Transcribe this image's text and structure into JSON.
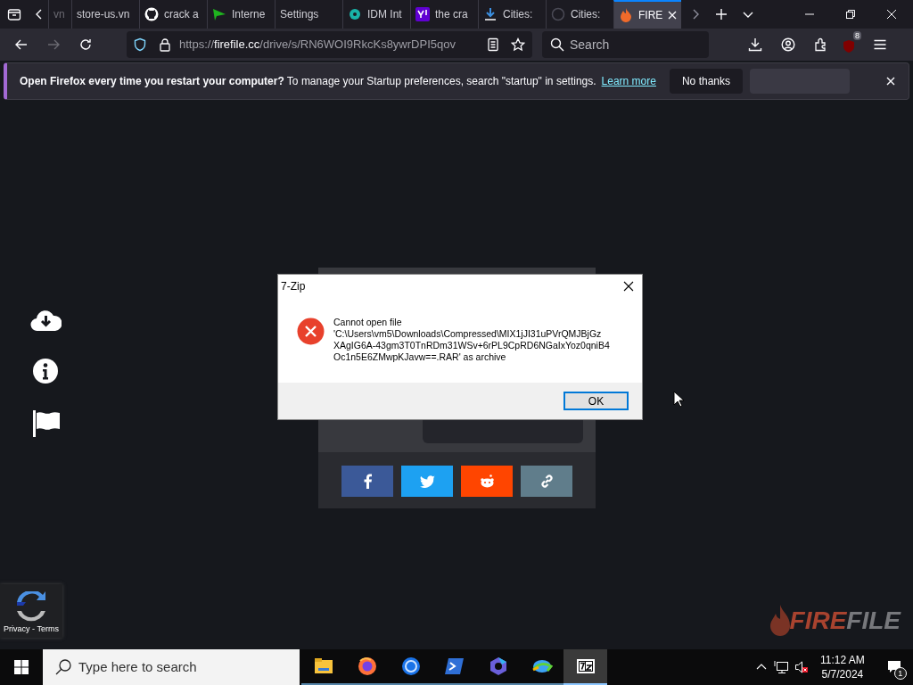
{
  "browser": {
    "tabs": [
      {
        "title": "vn",
        "kind": "none",
        "selected": false
      },
      {
        "title": "store-us.vn",
        "kind": "blank",
        "selected": false
      },
      {
        "title": "crack a",
        "kind": "github",
        "selected": false
      },
      {
        "title": "Interne",
        "kind": "flag",
        "selected": false
      },
      {
        "title": "Settings",
        "kind": "blank",
        "selected": false
      },
      {
        "title": "IDM Int",
        "kind": "idm",
        "selected": false
      },
      {
        "title": "the cra",
        "kind": "yahoo",
        "selected": false
      },
      {
        "title": "Cities: ",
        "kind": "download",
        "selected": false
      },
      {
        "title": "Cities: ",
        "kind": "steam",
        "selected": false
      },
      {
        "title": "FIRE",
        "kind": "fire",
        "selected": true
      }
    ],
    "url": "https://firefile.cc/drive/s/RN6WOI9RkcKs8ywrDPI5qov",
    "search_placeholder": "Search",
    "extension_badge": "8",
    "notification": {
      "question": "Open Firefox every time you restart your computer?",
      "text": "To manage your Startup preferences, search \"startup\" in settings.",
      "link": "Learn more",
      "button": "No thanks"
    }
  },
  "page": {
    "share_buttons": [
      {
        "kind": "facebook"
      },
      {
        "kind": "twitter"
      },
      {
        "kind": "reddit"
      },
      {
        "kind": "link"
      }
    ],
    "recaptcha": "Privacy - Terms",
    "logo": {
      "first": "FIRE",
      "second": "FILE"
    }
  },
  "dialog": {
    "title": "7-Zip",
    "message": "Cannot open file\n'C:\\Users\\vm5\\Downloads\\Compressed\\MIX1jJI31uPVrQMJBjGz\nXAgIG6A-43gm3T0TnRDm31WSv+6rPL9CpRD6NGaIxYoz0qniB4\nOc1n5E6ZMwpKJavw==.RAR' as archive",
    "button": "OK"
  },
  "taskbar": {
    "search_placeholder": "Type here to search",
    "apps": [
      {
        "kind": "explorer",
        "selected": false
      },
      {
        "kind": "firefox",
        "selected": false
      },
      {
        "kind": "chrome",
        "selected": false
      },
      {
        "kind": "powershell",
        "selected": false
      },
      {
        "kind": "copilot",
        "selected": false
      },
      {
        "kind": "idm",
        "selected": false
      },
      {
        "kind": "sevenzip",
        "selected": true
      }
    ],
    "time": "11:12 AM",
    "date": "5/7/2024",
    "notification_count": "1"
  }
}
